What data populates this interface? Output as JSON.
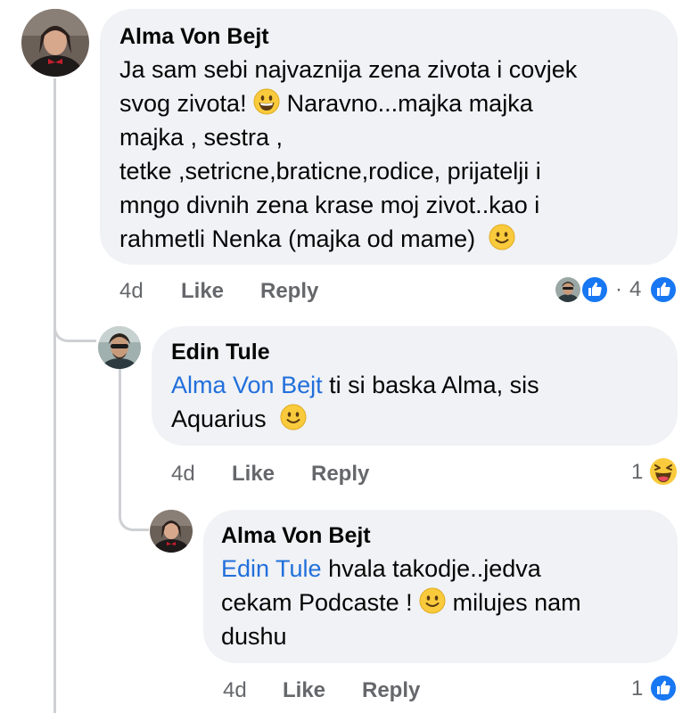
{
  "comments": [
    {
      "author": "Alma Von Bejt",
      "lines": [
        "Ja sam sebi najvaznija zena zivota i covjek",
        "svog zivota!",
        "Naravno...majka majka",
        "majka , sestra ,",
        "tetke ,setricne,braticne,rodice, prijatelji i",
        "mngo divnih zena krase moj zivot..kao i",
        "rahmetli Nenka (majka od mame)"
      ],
      "age": "4d",
      "like_label": "Like",
      "reply_label": "Reply",
      "reaction_count": "4",
      "reaction_prefix": "·"
    },
    {
      "author": "Edin Tule",
      "mention": "Alma Von Bejt",
      "text_1": " ti si baska Alma, sis",
      "text_2": "Aquarius",
      "age": "4d",
      "like_label": "Like",
      "reply_label": "Reply",
      "reaction_count": "1"
    },
    {
      "author": "Alma Von Bejt",
      "mention": "Edin Tule",
      "text_1": " hvala takodje..jedva",
      "text_2": "cekam Podcaste !",
      "text_3": " milujes nam",
      "text_4": "dushu",
      "age": "4d",
      "like_label": "Like",
      "reply_label": "Reply",
      "reaction_count": "1"
    }
  ],
  "colors": {
    "bubble": "#f0f2f5",
    "mention": "#216fdb",
    "meta": "#65676b",
    "like_blue": "#1877f2",
    "thread_line": "#ced0d4"
  },
  "icons": [
    "grinning-emoji-icon",
    "smiling-emoji-icon",
    "like-reaction-icon",
    "laughing-reaction-icon"
  ]
}
